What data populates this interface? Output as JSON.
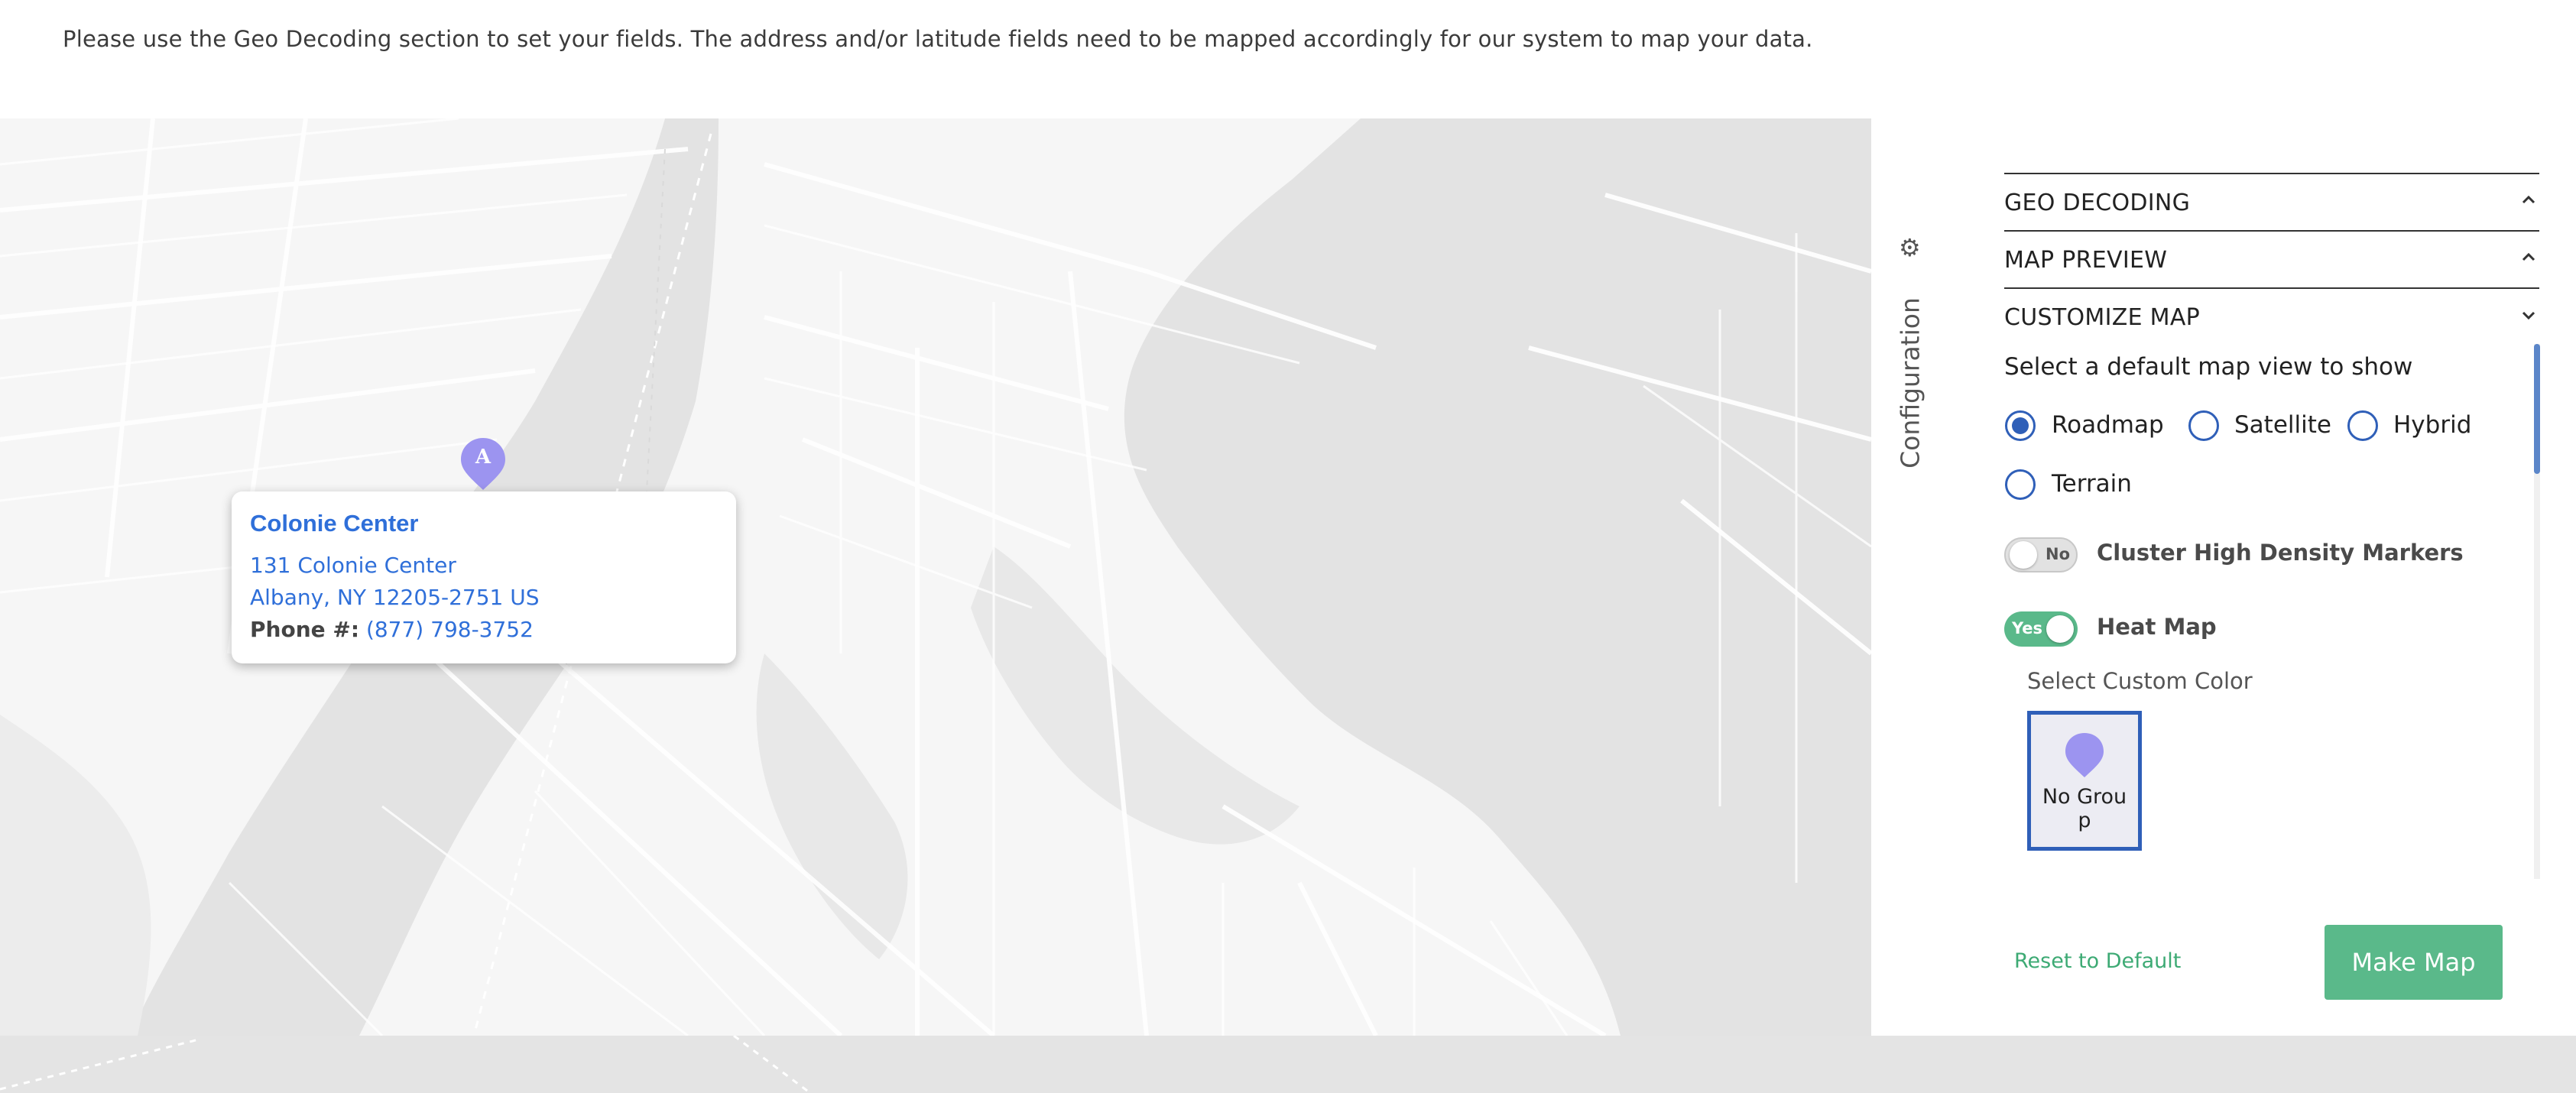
{
  "instructions": "Please use the Geo Decoding section to set your fields. The address and/or latitude fields need to be mapped accordingly for our system to map your data.",
  "map": {
    "marker_letter": "A",
    "marker_color": "#9c94f0",
    "info": {
      "title": "Colonie Center",
      "address_line1": "131 Colonie Center",
      "address_line2": "Albany, NY 12205-2751 US",
      "phone_label": "Phone #:",
      "phone": "(877) 798-3752"
    }
  },
  "config_tab": {
    "label": "Configuration",
    "icon": "gear-icon"
  },
  "panel": {
    "sections": [
      {
        "title": "GEO DECODING",
        "state": "collapsed",
        "icon": "chevron-up-icon"
      },
      {
        "title": "MAP PREVIEW",
        "state": "collapsed",
        "icon": "chevron-up-icon"
      },
      {
        "title": "CUSTOMIZE MAP",
        "state": "expanded",
        "icon": "chevron-down-icon"
      }
    ],
    "map_view": {
      "label": "Select a default map view to show",
      "options": [
        "Roadmap",
        "Satellite",
        "Hybrid",
        "Terrain"
      ],
      "selected": "Roadmap"
    },
    "cluster": {
      "label": "Cluster High Density Markers",
      "toggle_text": "No",
      "enabled": false
    },
    "heatmap": {
      "label": "Heat Map",
      "toggle_text": "Yes",
      "enabled": true
    },
    "custom_color": {
      "label": "Select Custom Color",
      "group_name": "No Group",
      "pin_color": "#9c94f0"
    },
    "reset_label": "Reset to Default",
    "make_map_label": "Make Map"
  },
  "colors": {
    "accent_blue": "#2f5fb8",
    "accent_green": "#5ab98a",
    "link_blue": "#2f6fd9"
  }
}
